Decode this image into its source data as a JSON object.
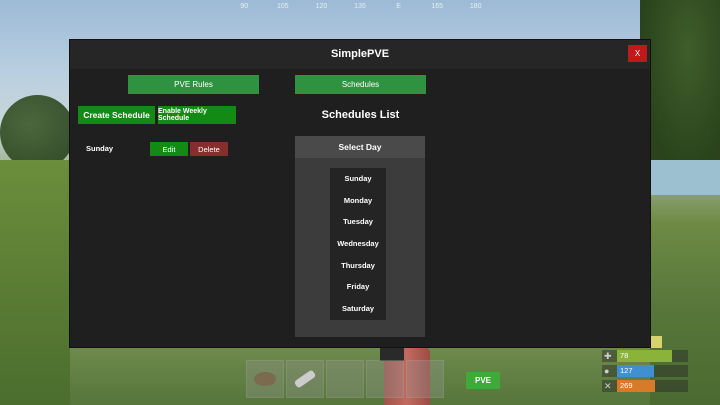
{
  "window": {
    "title": "SimplePVE",
    "close_label": "X"
  },
  "tabs": [
    {
      "label": "PVE Rules"
    },
    {
      "label": "Schedules"
    }
  ],
  "actions": {
    "create_label": "Create Schedule",
    "weekly_label": "Enable Weekly Schedule"
  },
  "schedules": [
    {
      "day": "Sunday",
      "edit_label": "Edit",
      "delete_label": "Delete"
    }
  ],
  "schedules_list": {
    "title": "Schedules List",
    "select_day_label": "Select Day",
    "days": [
      "Sunday",
      "Monday",
      "Tuesday",
      "Wednesday",
      "Thursday",
      "Friday",
      "Saturday"
    ]
  },
  "compass": [
    "90",
    "105",
    "120",
    "135",
    "E",
    "165",
    "180"
  ],
  "hud": {
    "pve_badge": "PVE",
    "health": {
      "value": "78",
      "level": 0.78,
      "color": "#8ab33a"
    },
    "hydration": {
      "value": "127",
      "level": 0.52,
      "color": "#3f8fd1"
    },
    "food": {
      "value": "269",
      "level": 0.54,
      "color": "#d9792a"
    }
  }
}
